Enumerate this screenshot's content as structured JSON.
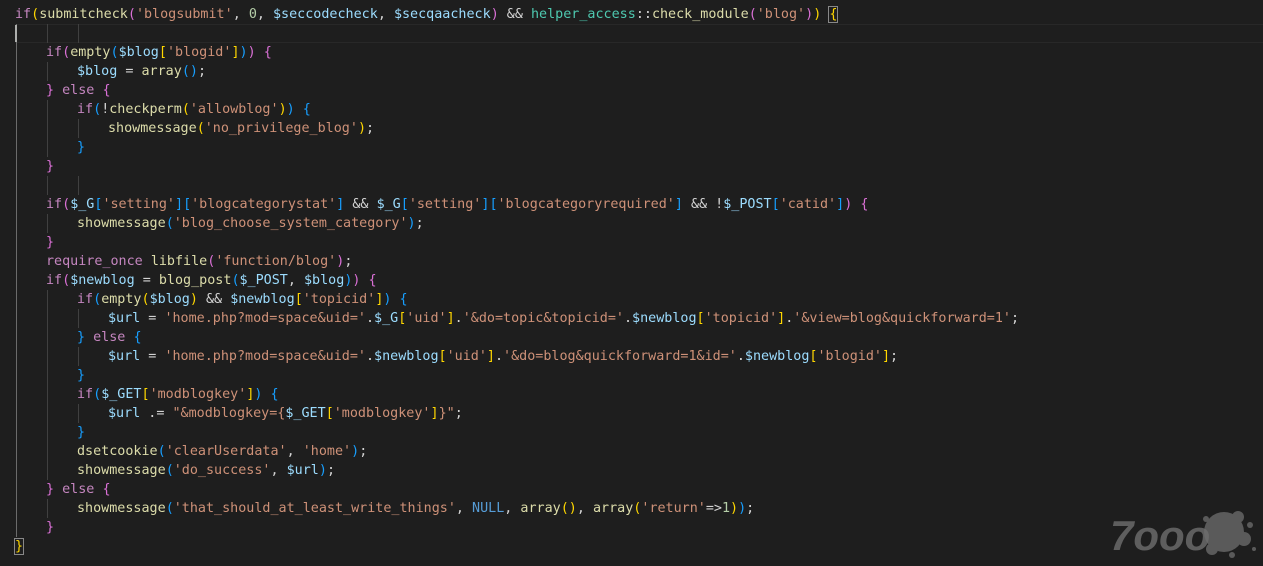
{
  "lines": [
    {
      "indent": 0,
      "tokens": [
        [
          "ctrl",
          "if"
        ],
        [
          "br1",
          "("
        ],
        [
          "fn",
          "submitcheck"
        ],
        [
          "br2",
          "("
        ],
        [
          "str",
          "'blogsubmit'"
        ],
        [
          "punc",
          ", "
        ],
        [
          "num",
          "0"
        ],
        [
          "punc",
          ", "
        ],
        [
          "var",
          "$seccodecheck"
        ],
        [
          "punc",
          ", "
        ],
        [
          "var",
          "$secqaacheck"
        ],
        [
          "br2",
          ")"
        ],
        [
          "punc",
          " && "
        ],
        [
          "cls",
          "helper_access"
        ],
        [
          "punc",
          "::"
        ],
        [
          "fn",
          "check_module"
        ],
        [
          "br2",
          "("
        ],
        [
          "str",
          "'blog'"
        ],
        [
          "br2",
          ")"
        ],
        [
          "br1",
          ")"
        ],
        [
          "punc",
          " "
        ],
        [
          "br1",
          "{"
        ]
      ]
    },
    {
      "indent": 0,
      "tokens": []
    },
    {
      "indent": 1,
      "tokens": [
        [
          "ctrl",
          "if"
        ],
        [
          "br2",
          "("
        ],
        [
          "fn",
          "empty"
        ],
        [
          "br3",
          "("
        ],
        [
          "var",
          "$blog"
        ],
        [
          "br1",
          "["
        ],
        [
          "str",
          "'blogid'"
        ],
        [
          "br1",
          "]"
        ],
        [
          "br3",
          ")"
        ],
        [
          "br2",
          ")"
        ],
        [
          "punc",
          " "
        ],
        [
          "br2",
          "{"
        ]
      ]
    },
    {
      "indent": 2,
      "tokens": [
        [
          "var",
          "$blog"
        ],
        [
          "punc",
          " = "
        ],
        [
          "fn",
          "array"
        ],
        [
          "br3",
          "("
        ],
        [
          "br3",
          ")"
        ],
        [
          "punc",
          ";"
        ]
      ]
    },
    {
      "indent": 1,
      "tokens": [
        [
          "br2",
          "}"
        ],
        [
          "punc",
          " "
        ],
        [
          "ctrl",
          "else"
        ],
        [
          "punc",
          " "
        ],
        [
          "br2",
          "{"
        ]
      ]
    },
    {
      "indent": 2,
      "tokens": [
        [
          "ctrl",
          "if"
        ],
        [
          "br3",
          "("
        ],
        [
          "punc",
          "!"
        ],
        [
          "fn",
          "checkperm"
        ],
        [
          "br1",
          "("
        ],
        [
          "str",
          "'allowblog'"
        ],
        [
          "br1",
          ")"
        ],
        [
          "br3",
          ")"
        ],
        [
          "punc",
          " "
        ],
        [
          "br3",
          "{"
        ]
      ]
    },
    {
      "indent": 3,
      "tokens": [
        [
          "fn",
          "showmessage"
        ],
        [
          "br1",
          "("
        ],
        [
          "str",
          "'no_privilege_blog'"
        ],
        [
          "br1",
          ")"
        ],
        [
          "punc",
          ";"
        ]
      ]
    },
    {
      "indent": 2,
      "tokens": [
        [
          "br3",
          "}"
        ]
      ]
    },
    {
      "indent": 1,
      "tokens": [
        [
          "br2",
          "}"
        ]
      ]
    },
    {
      "indent": 0,
      "tokens": []
    },
    {
      "indent": 1,
      "tokens": [
        [
          "ctrl",
          "if"
        ],
        [
          "br2",
          "("
        ],
        [
          "var",
          "$_G"
        ],
        [
          "br3",
          "["
        ],
        [
          "str",
          "'setting'"
        ],
        [
          "br3",
          "]"
        ],
        [
          "br3",
          "["
        ],
        [
          "str",
          "'blogcategorystat'"
        ],
        [
          "br3",
          "]"
        ],
        [
          "punc",
          " && "
        ],
        [
          "var",
          "$_G"
        ],
        [
          "br3",
          "["
        ],
        [
          "str",
          "'setting'"
        ],
        [
          "br3",
          "]"
        ],
        [
          "br3",
          "["
        ],
        [
          "str",
          "'blogcategoryrequired'"
        ],
        [
          "br3",
          "]"
        ],
        [
          "punc",
          " && !"
        ],
        [
          "var",
          "$_POST"
        ],
        [
          "br3",
          "["
        ],
        [
          "str",
          "'catid'"
        ],
        [
          "br3",
          "]"
        ],
        [
          "br2",
          ")"
        ],
        [
          "punc",
          " "
        ],
        [
          "br2",
          "{"
        ]
      ]
    },
    {
      "indent": 2,
      "tokens": [
        [
          "fn",
          "showmessage"
        ],
        [
          "br3",
          "("
        ],
        [
          "str",
          "'blog_choose_system_category'"
        ],
        [
          "br3",
          ")"
        ],
        [
          "punc",
          ";"
        ]
      ]
    },
    {
      "indent": 1,
      "tokens": [
        [
          "br2",
          "}"
        ]
      ]
    },
    {
      "indent": 1,
      "tokens": [
        [
          "ctrl",
          "require_once"
        ],
        [
          "punc",
          " "
        ],
        [
          "fn",
          "libfile"
        ],
        [
          "br2",
          "("
        ],
        [
          "str",
          "'function/blog'"
        ],
        [
          "br2",
          ")"
        ],
        [
          "punc",
          ";"
        ]
      ]
    },
    {
      "indent": 1,
      "tokens": [
        [
          "ctrl",
          "if"
        ],
        [
          "br2",
          "("
        ],
        [
          "var",
          "$newblog"
        ],
        [
          "punc",
          " = "
        ],
        [
          "fn",
          "blog_post"
        ],
        [
          "br3",
          "("
        ],
        [
          "var",
          "$_POST"
        ],
        [
          "punc",
          ", "
        ],
        [
          "var",
          "$blog"
        ],
        [
          "br3",
          ")"
        ],
        [
          "br2",
          ")"
        ],
        [
          "punc",
          " "
        ],
        [
          "br2",
          "{"
        ]
      ]
    },
    {
      "indent": 2,
      "tokens": [
        [
          "ctrl",
          "if"
        ],
        [
          "br3",
          "("
        ],
        [
          "fn",
          "empty"
        ],
        [
          "br1",
          "("
        ],
        [
          "var",
          "$blog"
        ],
        [
          "br1",
          ")"
        ],
        [
          "punc",
          " && "
        ],
        [
          "var",
          "$newblog"
        ],
        [
          "br1",
          "["
        ],
        [
          "str",
          "'topicid'"
        ],
        [
          "br1",
          "]"
        ],
        [
          "br3",
          ")"
        ],
        [
          "punc",
          " "
        ],
        [
          "br3",
          "{"
        ]
      ]
    },
    {
      "indent": 3,
      "tokens": [
        [
          "var",
          "$url"
        ],
        [
          "punc",
          " = "
        ],
        [
          "str",
          "'home.php?mod=space&uid='"
        ],
        [
          "punc",
          "."
        ],
        [
          "var",
          "$_G"
        ],
        [
          "br1",
          "["
        ],
        [
          "str",
          "'uid'"
        ],
        [
          "br1",
          "]"
        ],
        [
          "punc",
          "."
        ],
        [
          "str",
          "'&do=topic&topicid='"
        ],
        [
          "punc",
          "."
        ],
        [
          "var",
          "$newblog"
        ],
        [
          "br1",
          "["
        ],
        [
          "str",
          "'topicid'"
        ],
        [
          "br1",
          "]"
        ],
        [
          "punc",
          "."
        ],
        [
          "str",
          "'&view=blog&quickforward=1'"
        ],
        [
          "punc",
          ";"
        ]
      ]
    },
    {
      "indent": 2,
      "tokens": [
        [
          "br3",
          "}"
        ],
        [
          "punc",
          " "
        ],
        [
          "ctrl",
          "else"
        ],
        [
          "punc",
          " "
        ],
        [
          "br3",
          "{"
        ]
      ]
    },
    {
      "indent": 3,
      "tokens": [
        [
          "var",
          "$url"
        ],
        [
          "punc",
          " = "
        ],
        [
          "str",
          "'home.php?mod=space&uid='"
        ],
        [
          "punc",
          "."
        ],
        [
          "var",
          "$newblog"
        ],
        [
          "br1",
          "["
        ],
        [
          "str",
          "'uid'"
        ],
        [
          "br1",
          "]"
        ],
        [
          "punc",
          "."
        ],
        [
          "str",
          "'&do=blog&quickforward=1&id='"
        ],
        [
          "punc",
          "."
        ],
        [
          "var",
          "$newblog"
        ],
        [
          "br1",
          "["
        ],
        [
          "str",
          "'blogid'"
        ],
        [
          "br1",
          "]"
        ],
        [
          "punc",
          ";"
        ]
      ]
    },
    {
      "indent": 2,
      "tokens": [
        [
          "br3",
          "}"
        ]
      ]
    },
    {
      "indent": 2,
      "tokens": [
        [
          "ctrl",
          "if"
        ],
        [
          "br3",
          "("
        ],
        [
          "var",
          "$_GET"
        ],
        [
          "br1",
          "["
        ],
        [
          "str",
          "'modblogkey'"
        ],
        [
          "br1",
          "]"
        ],
        [
          "br3",
          ")"
        ],
        [
          "punc",
          " "
        ],
        [
          "br3",
          "{"
        ]
      ]
    },
    {
      "indent": 3,
      "tokens": [
        [
          "var",
          "$url"
        ],
        [
          "punc",
          " .= "
        ],
        [
          "str",
          "\"&modblogkey={"
        ],
        [
          "var",
          "$_GET"
        ],
        [
          "br1",
          "["
        ],
        [
          "str",
          "'modblogkey'"
        ],
        [
          "br1",
          "]"
        ],
        [
          "str",
          "}\""
        ],
        [
          "punc",
          ";"
        ]
      ]
    },
    {
      "indent": 2,
      "tokens": [
        [
          "br3",
          "}"
        ]
      ]
    },
    {
      "indent": 2,
      "tokens": [
        [
          "fn",
          "dsetcookie"
        ],
        [
          "br3",
          "("
        ],
        [
          "str",
          "'clearUserdata'"
        ],
        [
          "punc",
          ", "
        ],
        [
          "str",
          "'home'"
        ],
        [
          "br3",
          ")"
        ],
        [
          "punc",
          ";"
        ]
      ]
    },
    {
      "indent": 2,
      "tokens": [
        [
          "fn",
          "showmessage"
        ],
        [
          "br3",
          "("
        ],
        [
          "str",
          "'do_success'"
        ],
        [
          "punc",
          ", "
        ],
        [
          "var",
          "$url"
        ],
        [
          "br3",
          ")"
        ],
        [
          "punc",
          ";"
        ]
      ]
    },
    {
      "indent": 1,
      "tokens": [
        [
          "br2",
          "}"
        ],
        [
          "punc",
          " "
        ],
        [
          "ctrl",
          "else"
        ],
        [
          "punc",
          " "
        ],
        [
          "br2",
          "{"
        ]
      ]
    },
    {
      "indent": 2,
      "tokens": [
        [
          "fn",
          "showmessage"
        ],
        [
          "br3",
          "("
        ],
        [
          "str",
          "'that_should_at_least_write_things'"
        ],
        [
          "punc",
          ", "
        ],
        [
          "const",
          "NULL"
        ],
        [
          "punc",
          ", "
        ],
        [
          "fn",
          "array"
        ],
        [
          "br1",
          "("
        ],
        [
          "br1",
          ")"
        ],
        [
          "punc",
          ", "
        ],
        [
          "fn",
          "array"
        ],
        [
          "br1",
          "("
        ],
        [
          "str",
          "'return'"
        ],
        [
          "punc",
          "=>"
        ],
        [
          "num",
          "1"
        ],
        [
          "br1",
          ")"
        ],
        [
          "br3",
          ")"
        ],
        [
          "punc",
          ";"
        ]
      ]
    },
    {
      "indent": 1,
      "tokens": [
        [
          "br2",
          "}"
        ]
      ]
    },
    {
      "indent": 0,
      "tokens": [
        [
          "br1",
          "}"
        ]
      ]
    }
  ],
  "watermark": {
    "text": "7ooo"
  }
}
